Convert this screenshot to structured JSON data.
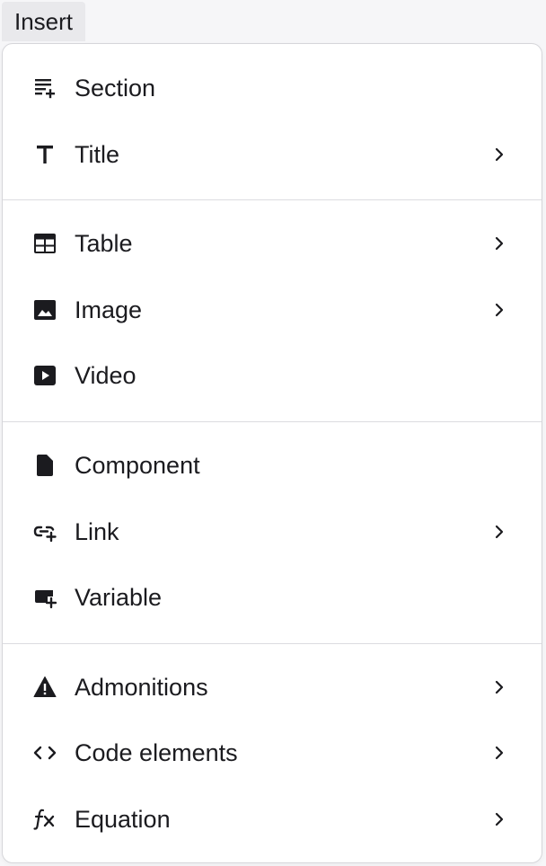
{
  "menubar": {
    "active_menu": "Insert"
  },
  "menu": {
    "items": [
      {
        "label": "Section",
        "icon": "section-add-icon",
        "submenu": false
      },
      {
        "label": "Title",
        "icon": "title-t-icon",
        "submenu": true
      },
      {
        "label": "Table",
        "icon": "table-icon",
        "submenu": true
      },
      {
        "label": "Image",
        "icon": "image-icon",
        "submenu": true
      },
      {
        "label": "Video",
        "icon": "video-icon",
        "submenu": false
      },
      {
        "label": "Component",
        "icon": "document-icon",
        "submenu": false
      },
      {
        "label": "Link",
        "icon": "link-add-icon",
        "submenu": true
      },
      {
        "label": "Variable",
        "icon": "variable-add-icon",
        "submenu": false
      },
      {
        "label": "Admonitions",
        "icon": "warning-icon",
        "submenu": true
      },
      {
        "label": "Code elements",
        "icon": "code-icon",
        "submenu": true
      },
      {
        "label": "Equation",
        "icon": "function-fx-icon",
        "submenu": true
      }
    ]
  }
}
